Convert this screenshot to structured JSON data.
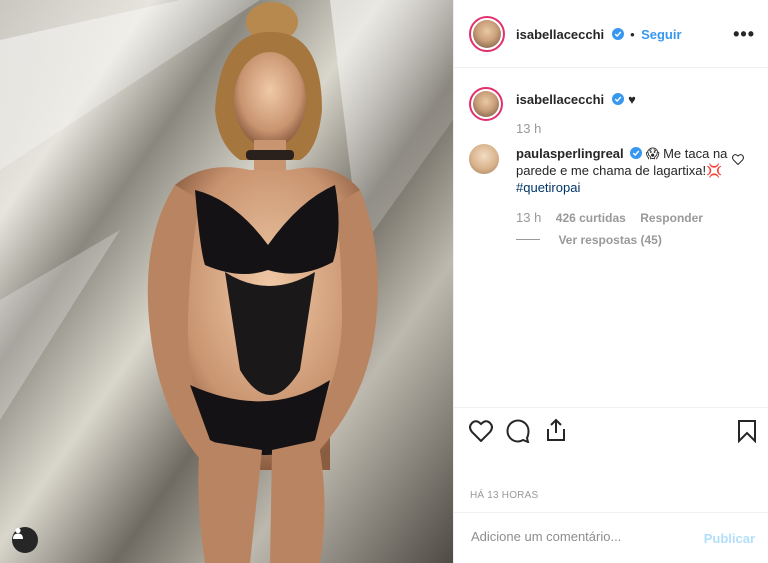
{
  "post": {
    "image_alt": "Woman in black lace bodysuit posing against a light-patterned wall"
  },
  "header": {
    "username": "isabellacecchi",
    "separator": "•",
    "follow_label": "Seguir",
    "more_label": "•••"
  },
  "caption": {
    "username": "isabellacecchi",
    "text": "♥",
    "time": "13 h"
  },
  "comment": {
    "username": "paulasperlingreal",
    "emoji": "😱",
    "text_part": "Me taca na parede e me chama de lagartixa!",
    "emoji2": "💢",
    "hashtag": "#quetiropai",
    "time": "13 h",
    "likes": "426 curtidas",
    "reply_label": "Responder",
    "view_replies": "Ver respostas (45)"
  },
  "timestamp": "HÁ 13 HORAS",
  "add_comment": {
    "placeholder": "Adicione um comentário...",
    "publish_label": "Publicar"
  },
  "colors": {
    "accent": "#3897f0",
    "text": "#262626",
    "meta": "#999999",
    "publish_disabled": "#b2dffc"
  }
}
